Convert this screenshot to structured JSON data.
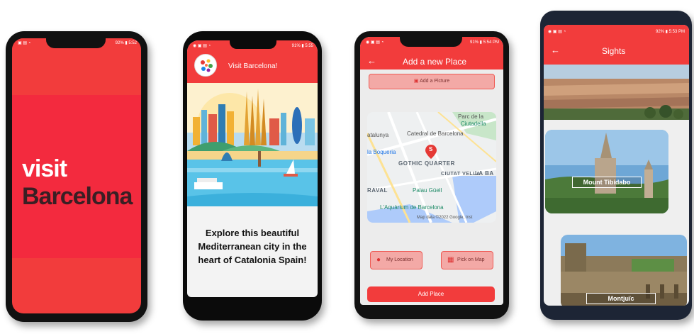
{
  "phone1": {
    "logo_line1": "visit",
    "logo_line2": "Barcelona",
    "status": "92% ▮ 5:52"
  },
  "phone2": {
    "title": "Visit Barcelona!",
    "status": "91% ▮ 5:55",
    "description": "Explore this beautiful Mediterranean city in the heart of Catalonia Spain!"
  },
  "phone3": {
    "title": "Add a new Place",
    "status": "91% ▮ 5:54 PM",
    "add_picture": "Add a Picture",
    "my_location": "My Location",
    "pick_on_map": "Pick on Map",
    "add_place": "Add Place",
    "map": {
      "labels": {
        "parc": "Parc de la",
        "ciutadella": "Ciutadella",
        "catalunya": "atalunya",
        "catedral": "Catedral de Barcelona",
        "boqueria": "la Boqueria",
        "gothic": "GOTHIC QUARTER",
        "ciutat_vella": "CIUTAT VELLA",
        "la_ba": "LA BA",
        "raval": "RAVAL",
        "palau": "Palau Güell",
        "aquarium": "L'Aquàrium de Barcelona",
        "mapdata": "Map data ©2022 Google, Inst"
      },
      "marker": "S"
    }
  },
  "phone4": {
    "title": "Sights",
    "status": "92% ▮ 5:53 PM",
    "cards": [
      {
        "label": "Mount Tibidabo"
      },
      {
        "label": "Montjuïc"
      }
    ]
  },
  "colors": {
    "brand_red": "#f23c3c",
    "button_pink": "#f3a9a6"
  }
}
